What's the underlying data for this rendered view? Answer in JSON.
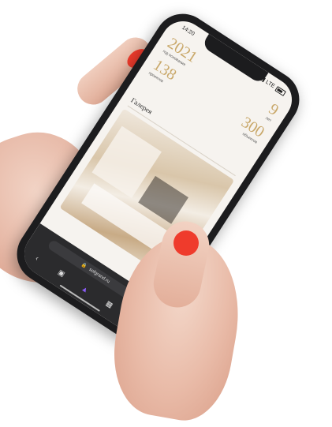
{
  "status_bar": {
    "time": "14:20",
    "network": "LTE"
  },
  "stats": [
    {
      "number": "2021",
      "caption": "год основания"
    },
    {
      "number": "9",
      "caption": "лет"
    },
    {
      "number": "138",
      "caption": "проектов"
    },
    {
      "number": "300",
      "caption": "объектов"
    }
  ],
  "gallery": {
    "title": "Галерея"
  },
  "browser": {
    "url": "sofgrand.ru",
    "back_icon": "chevron-left-icon",
    "tabs_icon": "tabs-icon",
    "assistant_icon": "alice-icon",
    "menu_icon": "menu-icon"
  },
  "colors": {
    "accent": "#c9a86a",
    "fab": "#2c8cf4",
    "nail": "#ef3b2c",
    "browser_bg": "#2b2b2d"
  }
}
